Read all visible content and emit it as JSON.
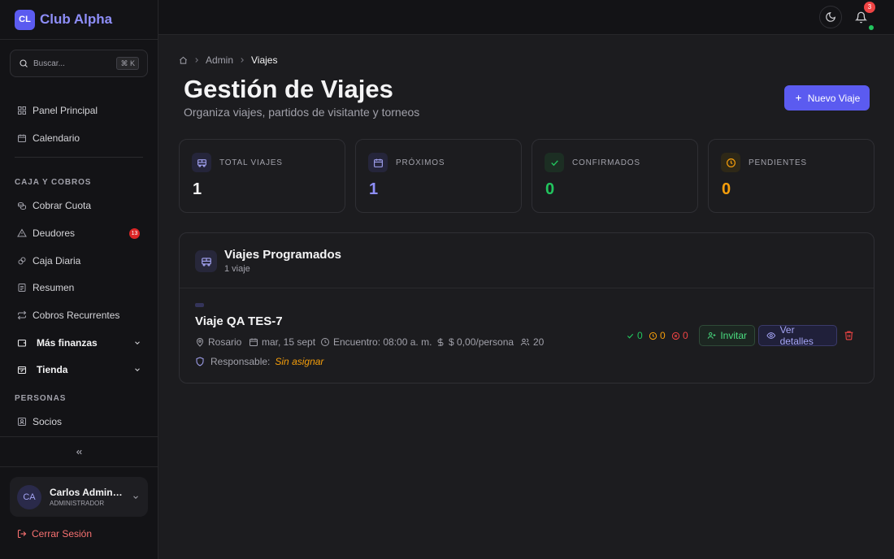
{
  "brand": {
    "logo": "CL",
    "name": "Club Alpha",
    "accent": "#5b5bf0"
  },
  "search": {
    "placeholder": "Buscar...",
    "shortcut": "⌘ K",
    "icon": "search-icon"
  },
  "nav": {
    "panel": "Panel Principal",
    "calendar": "Calendario",
    "section_finance": "CAJA Y COBROS",
    "collect_fee": "Cobrar Cuota",
    "debtors": "Deudores",
    "debtors_badge": "13",
    "daily_cash": "Caja Diaria",
    "summary": "Resumen",
    "recurring": "Cobros Recurrentes",
    "more_finance": "Más finanzas",
    "shop": "Tienda",
    "section_people": "PERSONAS",
    "members": "Socios"
  },
  "user": {
    "initials": "CA",
    "name": "Carlos Administrador",
    "role": "ADMINISTRADOR"
  },
  "logout_label": "Cerrar Sesión",
  "topbar": {
    "notifications": "3"
  },
  "breadcrumb": {
    "admin": "Admin",
    "current": "Viajes"
  },
  "page": {
    "title": "Gestión de Viajes",
    "subtitle": "Organiza viajes, partidos de visitante y torneos",
    "new_button": "Nuevo Viaje"
  },
  "stats": [
    {
      "label": "TOTAL VIAJES",
      "value": "1",
      "color": "#f4f4f5",
      "icon": "bus-icon"
    },
    {
      "label": "PRÓXIMOS",
      "value": "1",
      "color": "#8e8ef8",
      "icon": "calendar-icon"
    },
    {
      "label": "CONFIRMADOS",
      "value": "0",
      "color": "#22c55e",
      "icon": "check-icon"
    },
    {
      "label": "PENDIENTES",
      "value": "0",
      "color": "#f59e0b",
      "icon": "clock-icon"
    }
  ],
  "trips": {
    "title": "Viajes Programados",
    "count": "1 viaje",
    "item": {
      "name": "Viaje QA TES-7",
      "location": "Rosario",
      "date": "mar, 15 sept",
      "meeting": "Encuentro: 08:00 a. m.",
      "price": "$ 0,00/persona",
      "people": "20",
      "responsible_label": "Responsable:",
      "responsible_value": "Sin asignar",
      "confirmed": "0",
      "pending": "0",
      "rejected": "0",
      "invite_label": "Invitar",
      "details_label": "Ver detalles"
    }
  }
}
